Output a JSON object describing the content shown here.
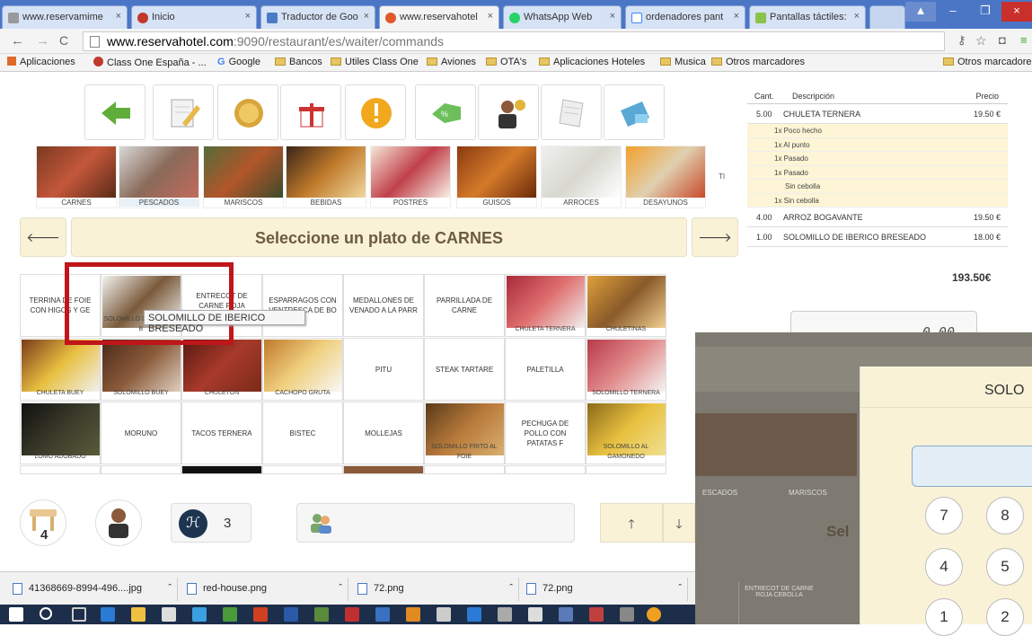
{
  "browser": {
    "tabs": [
      {
        "label": "www.reservamime",
        "active": false
      },
      {
        "label": "Inicio",
        "active": false
      },
      {
        "label": "Traductor de Goo",
        "active": false
      },
      {
        "label": "www.reservahotel",
        "active": true
      },
      {
        "label": "WhatsApp Web",
        "active": false
      },
      {
        "label": "ordenadores pant",
        "active": false
      },
      {
        "label": "Pantallas táctiles:",
        "active": false
      }
    ],
    "url_host": "www.reservahotel.com",
    "url_rest": ":9090/restaurant/es/waiter/commands",
    "bookmarks": [
      "Aplicaciones",
      "Class One España - ...",
      "Google",
      "Bancos",
      "Utiles Class One",
      "Aviones",
      "OTA's",
      "Aplicaciones Hoteles",
      "Musica",
      "Otros marcadores"
    ],
    "bookmarks_right": "Otros marcadores"
  },
  "categories": [
    "CARNES",
    "PESCADOS",
    "MARISCOS",
    "BEBIDAS",
    "POSTRES",
    "GUISOS",
    "ARROCES",
    "DESAYUNOS"
  ],
  "categories_more": "TI",
  "select_title": "Seleccione un plato de CARNES",
  "dishes": [
    {
      "label": "TERRINA DE FOIE CON HIGOS Y GE",
      "image": false
    },
    {
      "label": "SOLOMILLO DE IBERICO B",
      "image": true
    },
    {
      "label": "ENTRECOT DE CARNE ROJA CEBOLLA",
      "image": false
    },
    {
      "label": "ESPARRAGOS CON VENTRESCA DE BO",
      "image": false
    },
    {
      "label": "MEDALLONES DE VENADO A LA PARR",
      "image": false
    },
    {
      "label": "PARRILLADA DE CARNE",
      "image": false
    },
    {
      "label": "CHULETA TERNERA",
      "image": true
    },
    {
      "label": "CHULETINAS",
      "image": true
    },
    {
      "label": "CHULETA BUEY",
      "image": true
    },
    {
      "label": "SOLOMILLO BUEY",
      "image": true
    },
    {
      "label": "CHULETON",
      "image": true
    },
    {
      "label": "CACHOPO GRUTA",
      "image": true
    },
    {
      "label": "PITU",
      "image": false
    },
    {
      "label": "STEAK TARTARE",
      "image": false
    },
    {
      "label": "PALETILLA",
      "image": false
    },
    {
      "label": "SOLOMILLO TERNERA",
      "image": true
    },
    {
      "label": "LOMO ADOBADO",
      "image": true
    },
    {
      "label": "MORUNO",
      "image": false
    },
    {
      "label": "TACOS TERNERA",
      "image": false
    },
    {
      "label": "BISTEC",
      "image": false
    },
    {
      "label": "MOLLEJAS",
      "image": false
    },
    {
      "label": "SOLOMILLO FRITO AL FOIE",
      "image": true
    },
    {
      "label": "PECHUGA DE POLLO CON PATATAS F",
      "image": false
    },
    {
      "label": "SOLOMILLO AL GAMONEDO",
      "image": true
    }
  ],
  "tooltip": "SOLOMILLO DE IBERICO BRESEADO",
  "bottom": {
    "table_number": "4",
    "diners": "3"
  },
  "order": {
    "headers": {
      "qty": "Cant.",
      "desc": "Descripción",
      "price": "Precio"
    },
    "rows": [
      {
        "qty": "5.00",
        "desc": "CHULETA TERNERA",
        "price": "19.50 €",
        "mods": [
          "1x Poco hecho",
          "1x Al punto",
          "1x Pasado",
          "1x Pasado",
          "Sin cebolla",
          "1x Sin cebolla"
        ]
      },
      {
        "qty": "4.00",
        "desc": "ARROZ BOGAVANTE",
        "price": "19.50 €",
        "mods": []
      },
      {
        "qty": "1.00",
        "desc": "SOLOMILLO DE IBERICO BRESEADO",
        "price": "18.00 €",
        "mods": []
      }
    ],
    "total": "193.50€",
    "amount_display": "0.00"
  },
  "modal": {
    "title": "SOLO",
    "keys": [
      "7",
      "8",
      "4",
      "5",
      "1",
      "2"
    ],
    "bg_labels": [
      "ESCADOS",
      "MARISCOS",
      "Sel",
      "ENTRECOT DE CARNE ROJA CEBOLLA"
    ]
  },
  "downloads": [
    "41368669-8994-496....jpg",
    "red-house.png",
    "72.png",
    "72.png"
  ]
}
